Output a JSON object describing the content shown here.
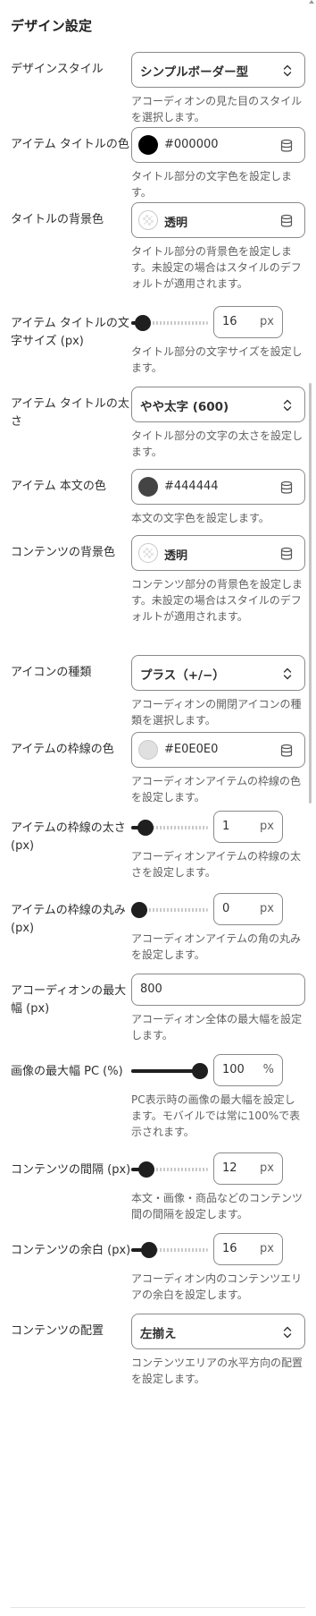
{
  "section": {
    "title": "デザイン設定"
  },
  "fields": {
    "design_style": {
      "label": "デザインスタイル",
      "value": "シンプルボーダー型",
      "help": "アコーディオンの見た目のスタイルを選択します。"
    },
    "title_color": {
      "label": "アイテム タイトルの色",
      "value": "#000000",
      "swatch": "#000000",
      "help": "タイトル部分の文字色を設定します。"
    },
    "title_bg": {
      "label": "タイトルの背景色",
      "value": "透明",
      "help": "タイトル部分の背景色を設定します。未設定の場合はスタイルのデフォルトが適用されます。"
    },
    "title_size": {
      "label": "アイテム タイトルの文字サイズ (px)",
      "value": "16",
      "unit": "px",
      "fraction": 0.06,
      "help": "タイトル部分の文字サイズを設定します。"
    },
    "title_weight": {
      "label": "アイテム タイトルの太さ",
      "value": "やや太字 (600)",
      "help": "タイトル部分の文字の太さを設定します。"
    },
    "body_color": {
      "label": "アイテム 本文の色",
      "value": "#444444",
      "swatch": "#444444",
      "help": "本文の文字色を設定します。"
    },
    "content_bg": {
      "label": "コンテンツの背景色",
      "value": "透明",
      "help": "コンテンツ部分の背景色を設定します。未設定の場合はスタイルのデフォルトが適用されます。"
    },
    "icon_type": {
      "label": "アイコンの種類",
      "value": "プラス（+/−）",
      "help": "アコーディオンの開閉アイコンの種類を選択します。"
    },
    "border_color": {
      "label": "アイテムの枠線の色",
      "value": "#E0E0E0",
      "swatch": "#E0E0E0",
      "help": "アコーディオンアイテムの枠線の色を設定します。"
    },
    "border_width": {
      "label": "アイテムの枠線の太さ (px)",
      "value": "1",
      "unit": "px",
      "fraction": 0.1,
      "help": "アコーディオンアイテムの枠線の太さを設定します。"
    },
    "border_radius": {
      "label": "アイテムの枠線の丸み (px)",
      "value": "0",
      "unit": "px",
      "fraction": 0.0,
      "help": "アコーディオンアイテムの角の丸みを設定します。"
    },
    "max_width": {
      "label": "アコーディオンの最大幅 (px)",
      "value": "800",
      "help": "アコーディオン全体の最大幅を設定します。"
    },
    "image_max_pc": {
      "label": "画像の最大幅 PC (%)",
      "value": "100",
      "unit": "%",
      "fraction": 1.0,
      "help": "PC表示時の画像の最大幅を設定します。モバイルでは常に100%で表示されます。"
    },
    "content_gap": {
      "label": "コンテンツの間隔 (px)",
      "value": "12",
      "unit": "px",
      "fraction": 0.12,
      "help": "本文・画像・商品などのコンテンツ間の間隔を設定します。"
    },
    "content_padding": {
      "label": "コンテンツの余白 (px)",
      "value": "16",
      "unit": "px",
      "fraction": 0.16,
      "help": "アコーディオン内のコンテンツエリアの余白を設定します。"
    },
    "content_align": {
      "label": "コンテンツの配置",
      "value": "左揃え",
      "help": "コンテンツエリアの水平方向の配置を設定します。"
    }
  },
  "icons": {
    "select": "chevron-up-down-icon",
    "database": "database-icon",
    "checker": "transparent-swatch-icon"
  },
  "colors": {
    "slider_fill": "#1f1f1f",
    "border": "#8a8a8a",
    "help_text": "#616161"
  }
}
